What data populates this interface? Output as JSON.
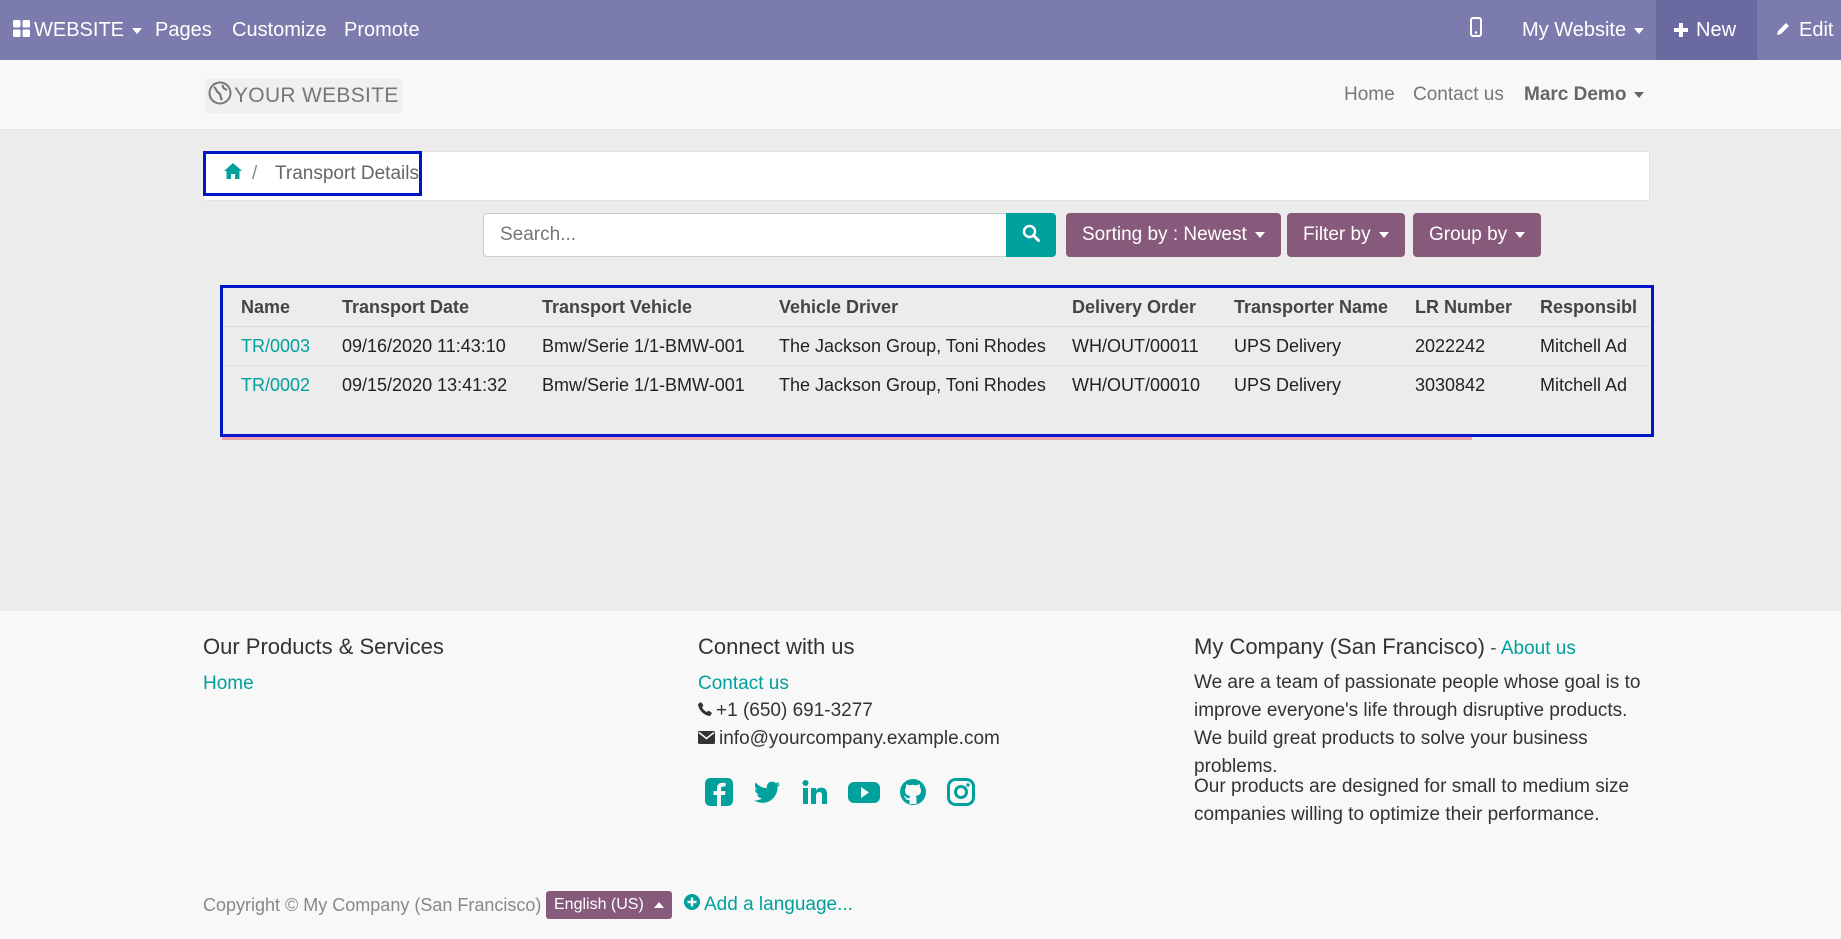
{
  "admin_bar": {
    "website_label": "WEBSITE",
    "pages": "Pages",
    "customize": "Customize",
    "promote": "Promote",
    "my_website": "My Website",
    "new_label": "New",
    "edit_label": "Edit"
  },
  "header": {
    "logo_text": "YOUR WEBSITE",
    "nav_home": "Home",
    "nav_contact": "Contact us",
    "user": "Marc Demo"
  },
  "breadcrumb": {
    "separator": "/",
    "current": "Transport Details"
  },
  "search": {
    "placeholder": "Search...",
    "sorting": "Sorting by : Newest",
    "filter": "Filter by",
    "group": "Group by"
  },
  "table": {
    "columns": [
      "Name",
      "Transport Date",
      "Transport Vehicle",
      "Vehicle Driver",
      "Delivery Order",
      "Transporter Name",
      "LR Number",
      "Responsibl"
    ],
    "rows": [
      [
        "TR/0003",
        "09/16/2020 11:43:10",
        "Bmw/Serie 1/1-BMW-001",
        "The Jackson Group, Toni Rhodes",
        "WH/OUT/00011",
        "UPS Delivery",
        "2022242",
        "Mitchell Ad"
      ],
      [
        "TR/0002",
        "09/15/2020 13:41:32",
        "Bmw/Serie 1/1-BMW-001",
        "The Jackson Group, Toni Rhodes",
        "WH/OUT/00010",
        "UPS Delivery",
        "3030842",
        "Mitchell Ad"
      ]
    ]
  },
  "footer": {
    "col1_title": "Our Products & Services",
    "col1_link": "Home",
    "col2_title": "Connect with us",
    "col2_link": "Contact us",
    "phone": "+1 (650) 691-3277",
    "email": "info@yourcompany.example.com",
    "col3_title": "My Company (San Francisco)",
    "col3_dash": " - ",
    "about_link": "About us",
    "about_p1": "We are a team of passionate people whose goal is to improve everyone's life through disruptive products. We build great products to solve your business problems.",
    "about_p2": "Our products are designed for small to medium size companies willing to optimize their performance.",
    "copyright": "Copyright © My Company (San Francisco)",
    "language": "English (US)",
    "add_language": "Add a language..."
  },
  "colors": {
    "admin_bar": "#7c7bad",
    "accent": "#00a09d",
    "button": "#875a7b",
    "highlight_box": "#0014c8"
  },
  "icons": [
    "apps-icon",
    "mobile-icon",
    "plus-icon",
    "pencil-icon",
    "globe-icon",
    "home-icon",
    "search-icon",
    "phone-icon",
    "envelope-icon",
    "facebook-icon",
    "twitter-icon",
    "linkedin-icon",
    "youtube-icon",
    "github-icon",
    "instagram-icon",
    "plus-circle-icon"
  ]
}
